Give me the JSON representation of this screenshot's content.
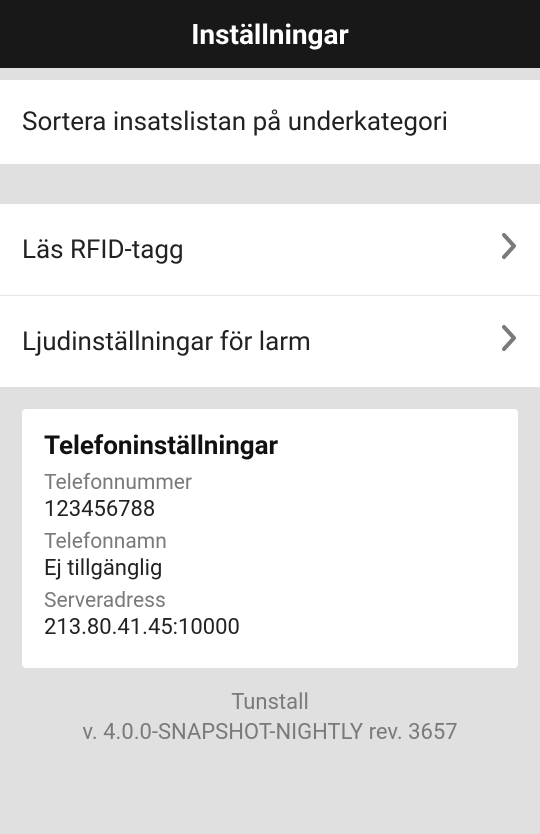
{
  "header": {
    "title": "Inställningar"
  },
  "rows": {
    "sort": "Sortera insatslistan på underkategori",
    "rfid": "Läs RFID-tagg",
    "sound": "Ljudinställningar för larm"
  },
  "card": {
    "title": "Telefoninställningar",
    "phone_label": "Telefonnummer",
    "phone_value": "123456788",
    "name_label": "Telefonnamn",
    "name_value": "Ej tillgänglig",
    "server_label": "Serveradress",
    "server_value": "213.80.41.45:10000"
  },
  "footer": {
    "line1": "Tunstall",
    "line2": "v. 4.0.0-SNAPSHOT-NIGHTLY rev. 3657"
  }
}
